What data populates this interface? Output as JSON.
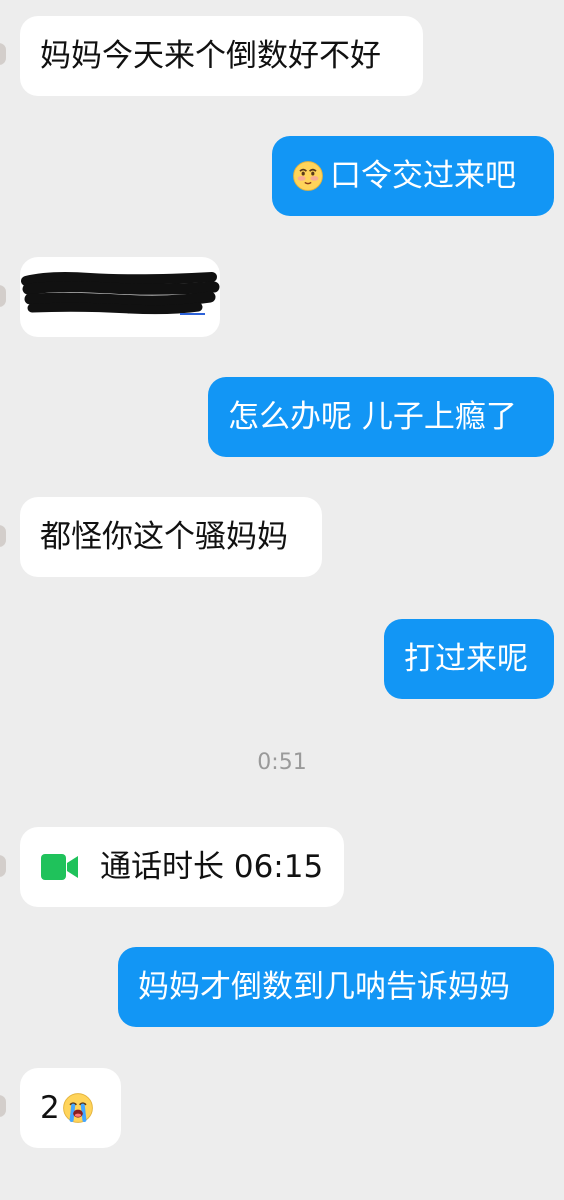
{
  "conversation": {
    "messages": [
      {
        "side": "incoming",
        "text": "妈妈今天来个倒数好不好"
      },
      {
        "side": "outgoing",
        "text": "口令交过来吧",
        "emoji": "blushing-face-icon"
      },
      {
        "side": "incoming",
        "text": "",
        "redacted": true
      },
      {
        "side": "outgoing",
        "text": "怎么办呢 儿子上瘾了"
      },
      {
        "side": "incoming",
        "text": "都怪你这个骚妈妈"
      },
      {
        "side": "outgoing",
        "text": "打过来呢"
      },
      {
        "side": "outgoing",
        "text": "妈妈才倒数到几呐告诉妈妈"
      },
      {
        "side": "incoming",
        "text": "2",
        "emoji": "crying-face-icon"
      }
    ],
    "timestamp": "0:51",
    "video_call": {
      "label": "通话时长 06:15",
      "icon": "video-camera-icon"
    }
  },
  "colors": {
    "background": "#ededed",
    "incoming_bubble": "#ffffff",
    "outgoing_bubble": "#1296f5",
    "video_icon": "#1fc25b",
    "timestamp_text": "#9a9a9a"
  }
}
